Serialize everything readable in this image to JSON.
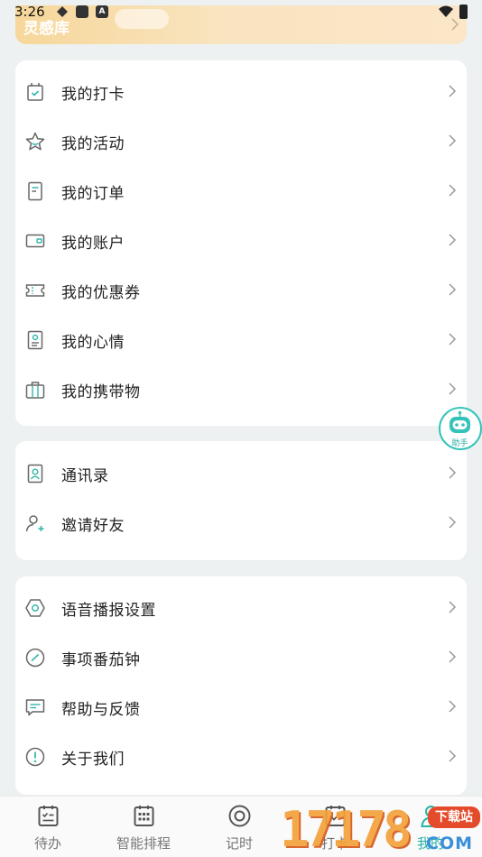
{
  "status_bar": {
    "time": "3:26",
    "notif_label": "A"
  },
  "banner": {
    "title": "灵感库"
  },
  "sections": [
    {
      "items": [
        {
          "label": "我的打卡",
          "icon": "checkin-icon"
        },
        {
          "label": "我的活动",
          "icon": "star-icon"
        },
        {
          "label": "我的订单",
          "icon": "order-icon"
        },
        {
          "label": "我的账户",
          "icon": "wallet-icon"
        },
        {
          "label": "我的优惠券",
          "icon": "coupon-icon"
        },
        {
          "label": "我的心情",
          "icon": "mood-icon"
        },
        {
          "label": "我的携带物",
          "icon": "luggage-icon"
        }
      ]
    },
    {
      "items": [
        {
          "label": "通讯录",
          "icon": "contacts-icon"
        },
        {
          "label": "邀请好友",
          "icon": "invite-icon"
        }
      ]
    },
    {
      "items": [
        {
          "label": "语音播报设置",
          "icon": "voice-settings-icon"
        },
        {
          "label": "事项番茄钟",
          "icon": "pomodoro-icon"
        },
        {
          "label": "帮助与反馈",
          "icon": "feedback-icon"
        },
        {
          "label": "关于我们",
          "icon": "about-icon"
        }
      ]
    }
  ],
  "assistant": {
    "label": "助手"
  },
  "tabbar": {
    "tabs": [
      {
        "label": "待办",
        "icon": "todo-icon",
        "active": false
      },
      {
        "label": "智能排程",
        "icon": "calendar-icon",
        "active": false
      },
      {
        "label": "记时",
        "icon": "timer-icon",
        "active": false
      },
      {
        "label": "打卡",
        "icon": "checkin-tab-icon",
        "active": false
      },
      {
        "label": "我的",
        "icon": "profile-icon",
        "active": true
      }
    ]
  },
  "watermark": {
    "digits": "17178",
    "top": "下载站",
    "bottom": "COM"
  },
  "colors": {
    "accent": "#26b3a8",
    "icon_teal": "#35b7ad",
    "background": "#eef1f1"
  }
}
